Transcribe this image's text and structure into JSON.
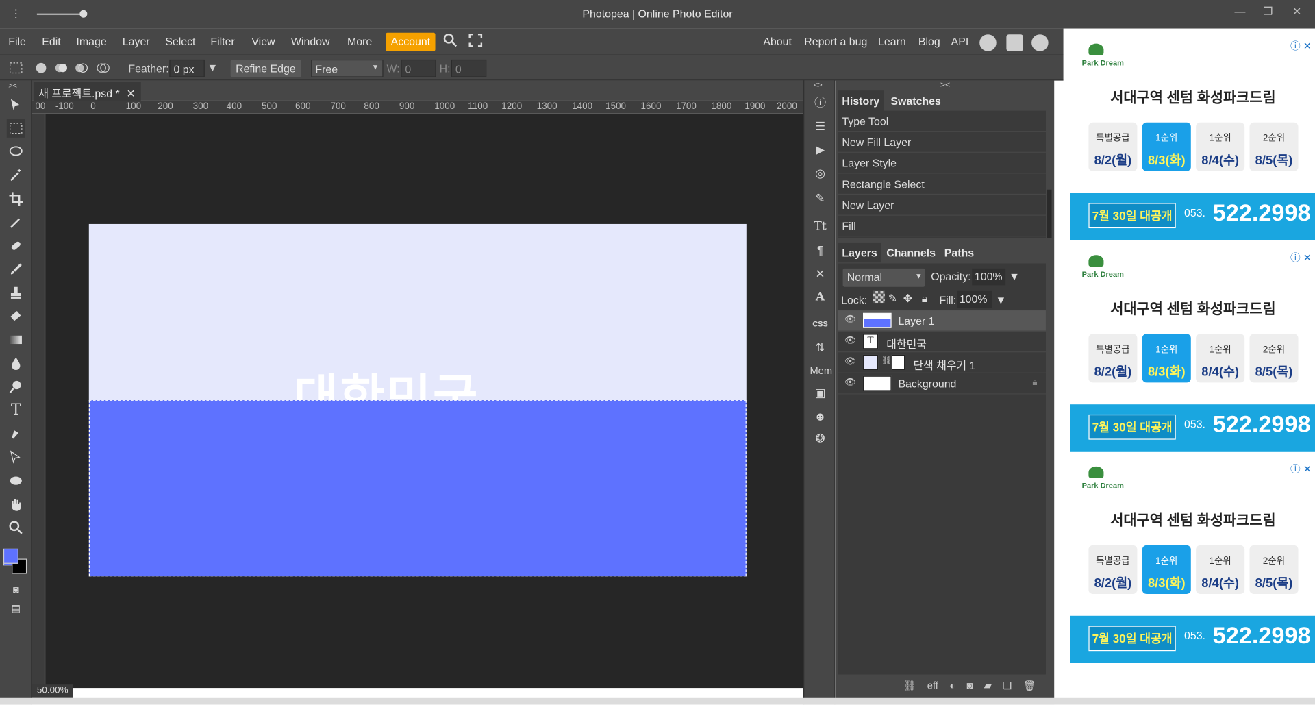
{
  "window": {
    "title": "Photopea | Online Photo Editor",
    "min_icon": "—",
    "restore_icon": "❐",
    "close_icon": "✕"
  },
  "menu": {
    "items": [
      "File",
      "Edit",
      "Image",
      "Layer",
      "Select",
      "Filter",
      "View",
      "Window",
      "More"
    ],
    "account": "Account",
    "links": [
      "About",
      "Report a bug",
      "Learn",
      "Blog",
      "API"
    ]
  },
  "options": {
    "feather_label": "Feather:",
    "feather_value": "0 px",
    "refine_edge": "Refine Edge",
    "style_value": "Free",
    "w_label": "W:",
    "w_value": "0",
    "h_label": "H:",
    "h_value": "0"
  },
  "document": {
    "tab_name": "새 프로젝트.psd *",
    "zoom": "50.00%",
    "canvas_text": "대한민국"
  },
  "ruler": {
    "h_ticks": [
      "00",
      "-100",
      "0",
      "100",
      "200",
      "300",
      "400",
      "500",
      "600",
      "700",
      "800",
      "900",
      "1000",
      "1100",
      "1200",
      "1300",
      "1400",
      "1500",
      "1600",
      "1700",
      "1800",
      "1900",
      "2000"
    ]
  },
  "history": {
    "tab_history": "History",
    "tab_swatches": "Swatches",
    "items": [
      "Type Tool",
      "New Fill Layer",
      "Layer Style",
      "Rectangle Select",
      "New Layer",
      "Fill"
    ]
  },
  "layers": {
    "tab_layers": "Layers",
    "tab_channels": "Channels",
    "tab_paths": "Paths",
    "blend_mode": "Normal",
    "opacity_label": "Opacity:",
    "opacity_value": "100%",
    "lock_label": "Lock:",
    "fill_label": "Fill:",
    "fill_value": "100%",
    "items": [
      {
        "name": "Layer 1",
        "selected": true
      },
      {
        "name": "대한민국",
        "selected": false
      },
      {
        "name": "단색 채우기 1",
        "selected": false
      },
      {
        "name": "Background",
        "selected": false
      }
    ],
    "footer_eff": "eff"
  },
  "iconcol": {
    "mem": "Mem",
    "css": "CSS"
  },
  "ads": [
    {
      "brand": "Park Dream",
      "headline": "서대구역 센텀  화성파크드림",
      "cards": [
        {
          "t": "특별공급",
          "d": "8/2(월)"
        },
        {
          "t": "1순위",
          "d": "8/3(화)"
        },
        {
          "t": "1순위",
          "d": "8/4(수)"
        },
        {
          "t": "2순위",
          "d": "8/5(목)"
        }
      ],
      "open": "7월 30일 대공개",
      "area": "053.",
      "phone": "522.2998"
    },
    {
      "brand": "Park Dream",
      "headline": "서대구역 센텀  화성파크드림",
      "cards": [
        {
          "t": "특별공급",
          "d": "8/2(월)"
        },
        {
          "t": "1순위",
          "d": "8/3(화)"
        },
        {
          "t": "1순위",
          "d": "8/4(수)"
        },
        {
          "t": "2순위",
          "d": "8/5(목)"
        }
      ],
      "open": "7월 30일 대공개",
      "area": "053.",
      "phone": "522.2998"
    },
    {
      "brand": "Park Dream",
      "headline": "서대구역 센텀  화성파크드림",
      "cards": [
        {
          "t": "특별공급",
          "d": "8/2(월)"
        },
        {
          "t": "1순위",
          "d": "8/3(화)"
        },
        {
          "t": "1순위",
          "d": "8/4(수)"
        },
        {
          "t": "2순위",
          "d": "8/5(목)"
        }
      ],
      "open": "7월 30일 대공개",
      "area": "053.",
      "phone": "522.2998"
    }
  ],
  "colors": {
    "accent": "#f5a100",
    "foreground": "#5e72ff",
    "canvas_top": "#e5e8fc",
    "ad_blue": "#1aa6e0"
  }
}
